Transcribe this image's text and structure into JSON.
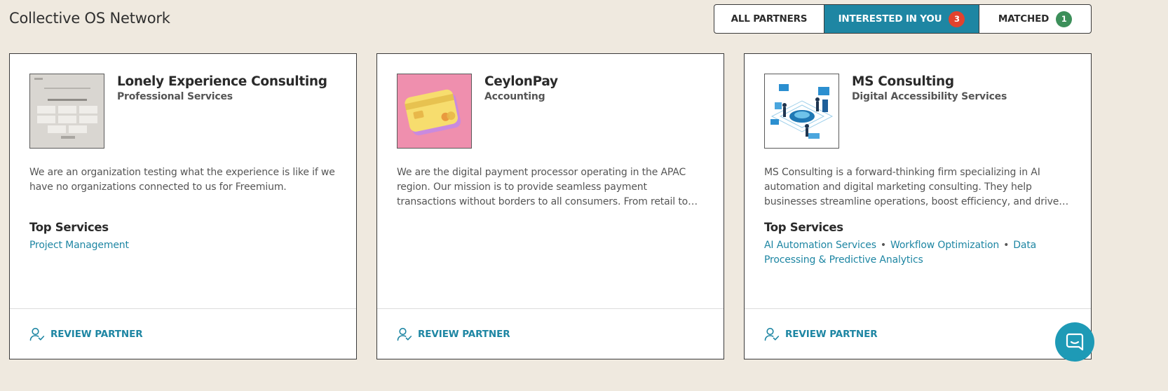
{
  "header": {
    "title": "Collective OS Network"
  },
  "tabs": [
    {
      "label": "ALL PARTNERS"
    },
    {
      "label": "INTERESTED IN YOU",
      "count": "3"
    },
    {
      "label": "MATCHED",
      "count": "1"
    }
  ],
  "colors": {
    "accent": "#1e86a3",
    "badge_red": "#e2422e",
    "badge_green": "#3c8f5a",
    "background": "#efe9df"
  },
  "cards": [
    {
      "name": "Lonely Experience Consulting",
      "category": "Professional Services",
      "description": "We are an organization testing what the experience is like if we have no organizations connected to us for Freemium.",
      "services_title": "Top Services",
      "services": [
        "Project Management"
      ],
      "action": "REVIEW PARTNER"
    },
    {
      "name": "CeylonPay",
      "category": "Accounting",
      "description": "We are the digital payment processor operating in the APAC region. Our mission is to provide seamless payment transactions without borders to all consumers. From retail to banking, peer-to-peer transfers and more.",
      "services_title": "",
      "services": [],
      "action": "REVIEW PARTNER"
    },
    {
      "name": "MS Consulting",
      "category": "Digital Accessibility Services",
      "description": "MS Consulting is a forward-thinking firm specializing in AI automation and digital marketing consulting. They help businesses streamline operations, boost efficiency, and drive growth through innovative solutions.",
      "services_title": "Top Services",
      "services": [
        "AI Automation Services",
        "Workflow Optimization",
        "Data Processing & Predictive Analytics"
      ],
      "action": "REVIEW PARTNER"
    }
  ],
  "icons": {
    "review": "user-check-icon",
    "chat": "chat-bubble-icon"
  }
}
